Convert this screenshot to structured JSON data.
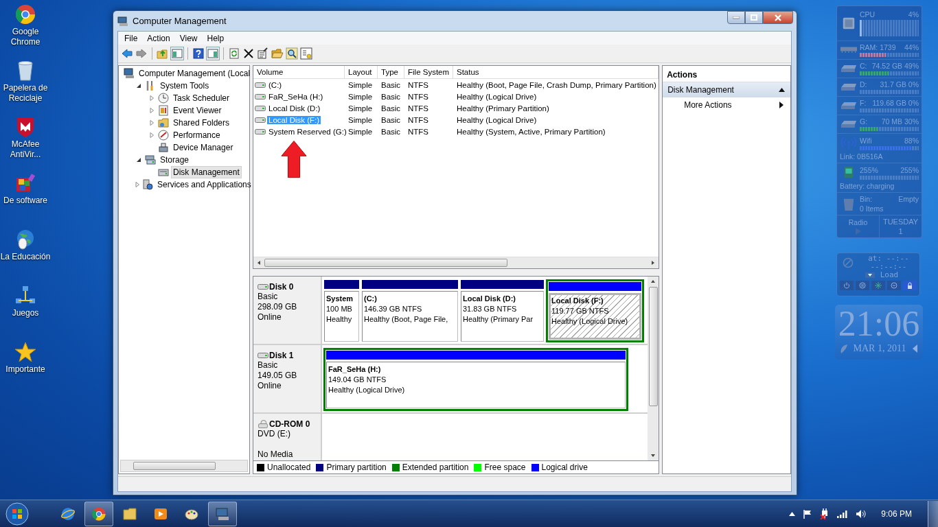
{
  "desktop_icons": [
    {
      "kind": "browser",
      "label": "Google Chrome"
    },
    {
      "kind": "recycle-bin",
      "label": "Papelera de Reciclaje"
    },
    {
      "kind": "shield",
      "label": "McAfee AntiVir..."
    },
    {
      "kind": "boxes",
      "label": "De software"
    },
    {
      "kind": "globe",
      "label": "La Educación"
    },
    {
      "kind": "network",
      "label": "Juegos"
    },
    {
      "kind": "star",
      "label": "Importante"
    }
  ],
  "window": {
    "title": "Computer Management",
    "menu": [
      "File",
      "Action",
      "View",
      "Help"
    ]
  },
  "tree": {
    "items": [
      {
        "kind": "computer",
        "label": "Computer Management (Local",
        "selected": false,
        "children": [
          {
            "kind": "tools",
            "label": "System Tools",
            "selected": false,
            "expanded": true,
            "children": [
              {
                "kind": "clock",
                "label": "Task Scheduler",
                "selected": false,
                "expanded": false
              },
              {
                "kind": "log",
                "label": "Event Viewer",
                "selected": false,
                "expanded": false
              },
              {
                "kind": "share",
                "label": "Shared Folders",
                "selected": false,
                "expanded": false
              },
              {
                "kind": "gauge",
                "label": "Performance",
                "selected": false,
                "expanded": false
              },
              {
                "kind": "device",
                "label": "Device Manager",
                "selected": false
              }
            ]
          },
          {
            "kind": "storage",
            "label": "Storage",
            "selected": false,
            "expanded": true,
            "children": [
              {
                "kind": "disk",
                "label": "Disk Management",
                "selected": true
              }
            ]
          },
          {
            "kind": "services",
            "label": "Services and Applications",
            "selected": false,
            "expanded": false
          }
        ]
      }
    ]
  },
  "volumes": {
    "columns": [
      "Volume",
      "Layout",
      "Type",
      "File System",
      "Status"
    ],
    "rows": [
      {
        "volume": "(C:)",
        "layout": "Simple",
        "type": "Basic",
        "file_system": "NTFS",
        "status": "Healthy (Boot, Page File, Crash Dump, Primary Partition)",
        "selected": false
      },
      {
        "volume": "FaR_SeHa (H:)",
        "layout": "Simple",
        "type": "Basic",
        "file_system": "NTFS",
        "status": "Healthy (Logical Drive)",
        "selected": false
      },
      {
        "volume": "Local Disk (D:)",
        "layout": "Simple",
        "type": "Basic",
        "file_system": "NTFS",
        "status": "Healthy (Primary Partition)",
        "selected": false
      },
      {
        "volume": "Local Disk (F:)",
        "layout": "Simple",
        "type": "Basic",
        "file_system": "NTFS",
        "status": "Healthy (Logical Drive)",
        "selected": true
      },
      {
        "volume": "System Reserved (G:)",
        "layout": "Simple",
        "type": "Basic",
        "file_system": "NTFS",
        "status": "Healthy (System, Active, Primary Partition)",
        "selected": false
      }
    ]
  },
  "disks": [
    {
      "kind": "hdd",
      "name": "Disk 0",
      "type": "Basic",
      "size": "298.09 GB",
      "state": "Online",
      "partitions": [
        {
          "name": "System",
          "size": "100 MB",
          "status": "Healthy",
          "kind": "primary",
          "selected": false
        },
        {
          "name": "(C:)",
          "size": "146.39 GB NTFS",
          "status": "Healthy (Boot, Page File,",
          "kind": "primary",
          "selected": false
        },
        {
          "name": "Local Disk  (D:)",
          "size": "31.83 GB NTFS",
          "status": "Healthy (Primary Par",
          "kind": "primary",
          "selected": false
        },
        {
          "name": "Local Disk  (F:)",
          "size": "119.77 GB NTFS",
          "status": "Healthy (Logical Drive)",
          "kind": "logical",
          "selected": true
        }
      ]
    },
    {
      "kind": "hdd",
      "name": "Disk 1",
      "type": "Basic",
      "size": "149.05 GB",
      "state": "Online",
      "partitions": [
        {
          "name": "FaR_SeHa  (H:)",
          "size": "149.04 GB NTFS",
          "status": "Healthy (Logical Drive)",
          "kind": "logical",
          "selected": false
        }
      ]
    },
    {
      "kind": "cdrom",
      "name": "CD-ROM 0",
      "type": "DVD (E:)",
      "state": "No Media"
    }
  ],
  "legend": [
    {
      "label": "Unallocated",
      "color": "#000000"
    },
    {
      "label": "Primary partition",
      "color": "#000080"
    },
    {
      "label": "Extended partition",
      "color": "#008000"
    },
    {
      "label": "Free space",
      "color": "#00ff00"
    },
    {
      "label": "Logical drive",
      "color": "#0000ff"
    }
  ],
  "actions": {
    "header": "Actions",
    "section": {
      "title": "Disk Management",
      "expanded": true,
      "items": [
        {
          "label": "More Actions"
        }
      ]
    }
  },
  "gadgets": {
    "meters": [
      {
        "kind": "cpu",
        "label": "CPU",
        "reading": "4%",
        "level": 0.04
      },
      {
        "kind": "ram",
        "label": "RAM: 1739",
        "reading": "44%",
        "level": 0.44
      },
      {
        "kind": "drive",
        "label": "C:",
        "reading": "74.52 GB 49%",
        "level": 0.49
      },
      {
        "kind": "drive",
        "label": "D:",
        "reading": "31.7 GB 0%",
        "level": 0
      },
      {
        "kind": "drive",
        "label": "F:",
        "reading": "119.68 GB 0%",
        "level": 0
      },
      {
        "kind": "drive",
        "label": "G:",
        "reading": "70 MB 30%",
        "level": 0.3
      },
      {
        "kind": "wifi",
        "label": "Wifi",
        "reading": "88%",
        "level": 0.88,
        "note": "Link: 0B516A"
      },
      {
        "kind": "battery",
        "label": "255%",
        "reading": "255%",
        "level": 0,
        "note": "Battery: charging"
      }
    ],
    "bin": {
      "label": "Bin:",
      "state": "Empty",
      "count": "0 Items"
    },
    "radio": {
      "label": "Radio"
    },
    "calendar": {
      "day": "TUESDAY",
      "date": "1"
    },
    "shutdown": {
      "time": "at: --:--",
      "countdown": "--:--:--",
      "action": "Load"
    },
    "clock": {
      "time": "21:06",
      "date": "MAR 1, 2011"
    }
  },
  "taskbar": {
    "apps": [
      {
        "kind": "globe",
        "running": false
      },
      {
        "kind": "browser",
        "running": true
      },
      {
        "kind": "folder",
        "running": false
      },
      {
        "kind": "media",
        "running": false
      },
      {
        "kind": "paint",
        "running": false
      },
      {
        "kind": "console",
        "running": true
      }
    ],
    "clock": "9:06 PM"
  }
}
